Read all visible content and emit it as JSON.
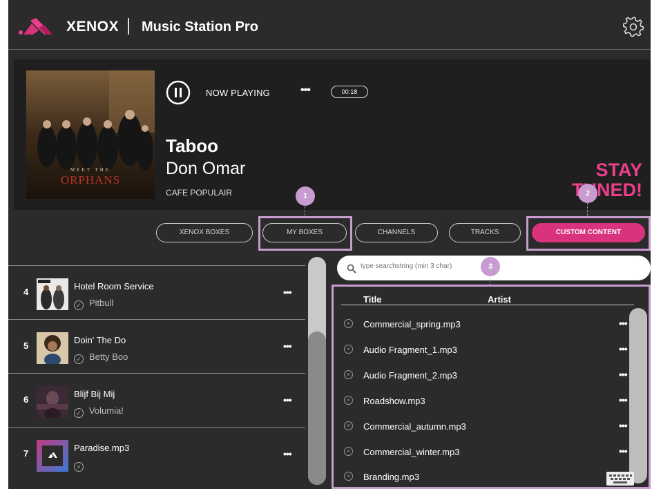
{
  "header": {
    "brand": "XENOX",
    "app_title": "Music Station Pro",
    "settings_icon": "gear-icon"
  },
  "now_playing": {
    "label": "NOW PLAYING",
    "more": "•••",
    "time": "00:18",
    "title": "Taboo",
    "artist": "Don Omar",
    "channel": "CAFE POPULAIR",
    "cover_caption": "ORPHANS",
    "cover_top": "MEET THE",
    "stay_line1": "STAY",
    "stay_line2": "TUNED!"
  },
  "nav": {
    "xenox_boxes": "XENOX BOXES",
    "my_boxes": "MY BOXES",
    "channels": "CHANNELS",
    "tracks": "TRACKS",
    "custom_content": "CUSTOM CONTENT"
  },
  "badges": [
    "1",
    "2",
    "3"
  ],
  "playlist": [
    {
      "num": "4",
      "title": "Hotel Room Service",
      "artist": "Pitbull",
      "status": "check"
    },
    {
      "num": "5",
      "title": "Doin' The Do",
      "artist": "Betty Boo",
      "status": "check"
    },
    {
      "num": "6",
      "title": "Blijf Bij Mij",
      "artist": "Volumia!",
      "status": "check"
    },
    {
      "num": "7",
      "title": "Paradise.mp3",
      "artist": "",
      "status": "remove"
    }
  ],
  "row_more": "•••",
  "search": {
    "placeholder": "type searchstring (min 3 char)"
  },
  "content_table": {
    "headers": [
      "Title",
      "Artist"
    ],
    "rows": [
      "Commercial_spring.mp3",
      "Audio Fragment_1.mp3",
      "Audio Fragment_2.mp3",
      "Roadshow.mp3",
      "Commercial_autumn.mp3",
      "Commercial_winter.mp3",
      "Branding.mp3"
    ]
  },
  "colors": {
    "accent": "#d8337c",
    "highlight": "#c89bd1",
    "background": "#2b2b2b"
  }
}
